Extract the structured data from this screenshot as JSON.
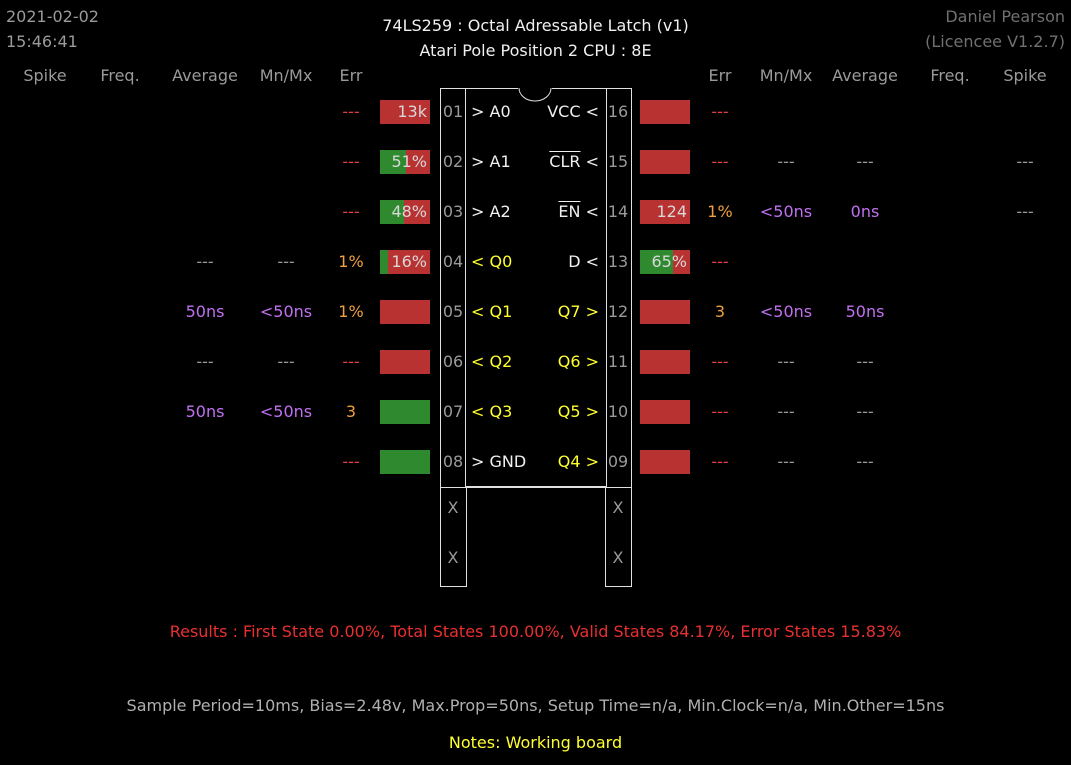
{
  "header": {
    "date": "2021-02-02",
    "time": "15:46:41",
    "title": "74LS259  :  Octal Adressable Latch (v1)",
    "subtitle": "Atari Pole Position 2 CPU : 8E",
    "user": "Daniel Pearson",
    "licence": "(Licencee V1.2.7)"
  },
  "columns_left": [
    "Spike",
    "Freq.",
    "Average",
    "Mn/Mx",
    "Err"
  ],
  "columns_right": [
    "Err",
    "Mn/Mx",
    "Average",
    "Freq.",
    "Spike"
  ],
  "left_pins": [
    {
      "num": "01",
      "name": "> A0",
      "color": "white",
      "bar": {
        "label": "13k",
        "green": 0
      },
      "err": "---",
      "err_color": "dark",
      "mnmx": "",
      "avg": "",
      "freq": "",
      "spike": ""
    },
    {
      "num": "02",
      "name": "> A1",
      "color": "white",
      "bar": {
        "label": "51%",
        "green": 0.51
      },
      "err": "---",
      "err_color": "dark",
      "mnmx": "",
      "avg": "",
      "freq": "",
      "spike": ""
    },
    {
      "num": "03",
      "name": "> A2",
      "color": "white",
      "bar": {
        "label": "48%",
        "green": 0.48
      },
      "err": "---",
      "err_color": "dark",
      "mnmx": "",
      "avg": "",
      "freq": "",
      "spike": ""
    },
    {
      "num": "04",
      "name": "< Q0",
      "color": "yellow",
      "bar": {
        "label": "16%",
        "green": 0.16
      },
      "err": "1%",
      "err_color": "orange",
      "mnmx": "---",
      "avg": "---",
      "freq": "",
      "spike": ""
    },
    {
      "num": "05",
      "name": "< Q1",
      "color": "yellow",
      "bar": {
        "label": "",
        "green": 0
      },
      "err": "1%",
      "err_color": "orange",
      "mnmx": "<50ns",
      "avg": "50ns",
      "freq": "",
      "spike": ""
    },
    {
      "num": "06",
      "name": "< Q2",
      "color": "yellow",
      "bar": {
        "label": "",
        "green": 0
      },
      "err": "---",
      "err_color": "dark",
      "mnmx": "---",
      "avg": "---",
      "freq": "",
      "spike": ""
    },
    {
      "num": "07",
      "name": "< Q3",
      "color": "yellow",
      "bar": {
        "label": "",
        "green": 1
      },
      "err": "3",
      "err_color": "orange",
      "mnmx": "<50ns",
      "avg": "50ns",
      "freq": "",
      "spike": ""
    },
    {
      "num": "08",
      "name": "> GND",
      "color": "white",
      "bar": {
        "label": "",
        "green": 1
      },
      "err": "---",
      "err_color": "dark",
      "mnmx": "",
      "avg": "",
      "freq": "",
      "spike": ""
    }
  ],
  "right_pins": [
    {
      "num": "16",
      "name": "VCC <",
      "over": "",
      "color": "white",
      "bar": {
        "label": "",
        "green": 0
      },
      "err": "---",
      "err_color": "dark",
      "mnmx": "",
      "avg": "",
      "freq": "",
      "spike": ""
    },
    {
      "num": "15",
      "name": "CLR <",
      "over": "CLR",
      "color": "white",
      "bar": {
        "label": "",
        "green": 0
      },
      "err": "---",
      "err_color": "dark",
      "mnmx": "---",
      "avg": "---",
      "freq": "",
      "spike": "---"
    },
    {
      "num": "14",
      "name": "EN <",
      "over": "EN",
      "color": "white",
      "bar": {
        "label": "124",
        "green": 0
      },
      "err": "1%",
      "err_color": "orange",
      "mnmx": "<50ns",
      "avg": "0ns",
      "freq": "",
      "spike": "---"
    },
    {
      "num": "13",
      "name": "D <",
      "over": "",
      "color": "white",
      "bar": {
        "label": "65%",
        "green": 0.65
      },
      "err": "---",
      "err_color": "dark",
      "mnmx": "",
      "avg": "",
      "freq": "",
      "spike": ""
    },
    {
      "num": "12",
      "name": "Q7 >",
      "over": "",
      "color": "yellow",
      "bar": {
        "label": "",
        "green": 0
      },
      "err": "3",
      "err_color": "orange",
      "mnmx": "<50ns",
      "avg": "50ns",
      "freq": "",
      "spike": ""
    },
    {
      "num": "11",
      "name": "Q6 >",
      "over": "",
      "color": "yellow",
      "bar": {
        "label": "",
        "green": 0
      },
      "err": "---",
      "err_color": "dark",
      "mnmx": "---",
      "avg": "---",
      "freq": "",
      "spike": ""
    },
    {
      "num": "10",
      "name": "Q5 >",
      "over": "",
      "color": "yellow",
      "bar": {
        "label": "",
        "green": 0
      },
      "err": "---",
      "err_color": "dark",
      "mnmx": "---",
      "avg": "---",
      "freq": "",
      "spike": ""
    },
    {
      "num": "09",
      "name": "Q4 >",
      "over": "",
      "color": "yellow",
      "bar": {
        "label": "",
        "green": 0
      },
      "err": "---",
      "err_color": "dark",
      "mnmx": "---",
      "avg": "---",
      "freq": "",
      "spike": ""
    }
  ],
  "x_marks": [
    "X",
    "X"
  ],
  "results": "Results  :  First State 0.00%,  Total States 100.00%,  Valid States 84.17%,  Error States 15.83%",
  "params": "Sample Period=10ms,  Bias=2.48v,  Max.Prop=50ns,  Setup Time=n/a,  Min.Clock=n/a,  Min.Other=15ns",
  "notes": "Notes:  Working board",
  "colors": {
    "bar_red": "#b83232",
    "bar_green": "#2f8a2f",
    "err_orange": "#f0a040",
    "err_dark": "#e04040",
    "purple": "#c070f0",
    "yellow": "#ffff30",
    "results": "#e83030"
  }
}
